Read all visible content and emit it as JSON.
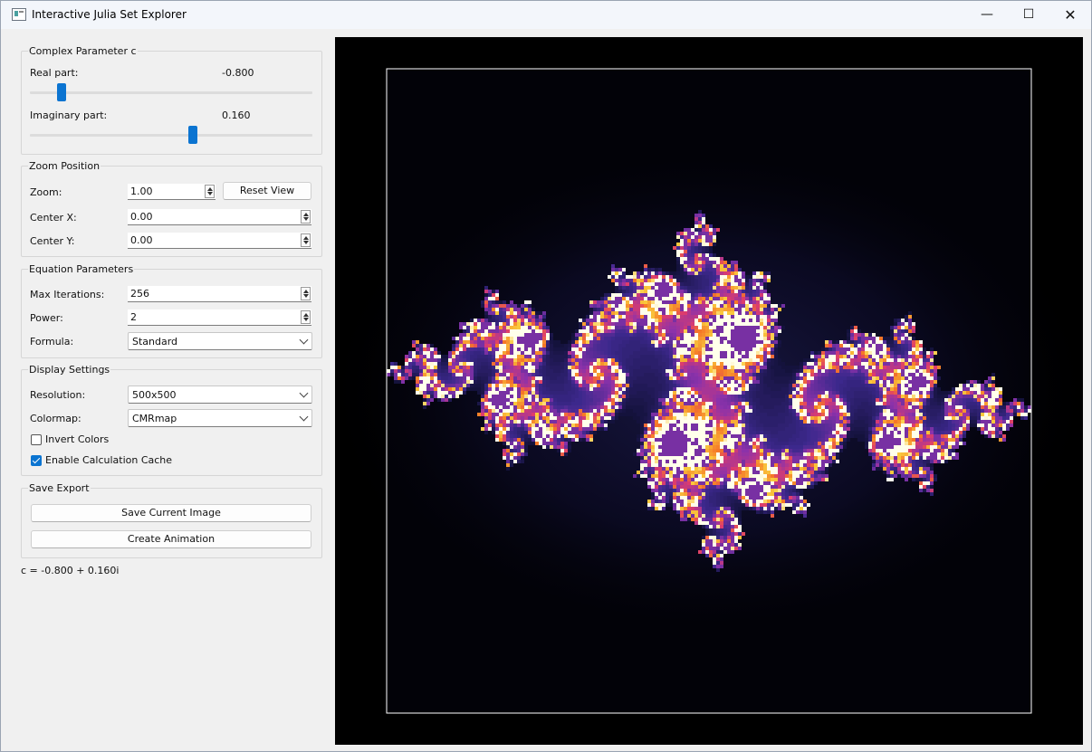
{
  "window": {
    "title": "Interactive Julia Set Explorer"
  },
  "controls": {
    "window_minimize": "—",
    "window_maximize": "☐",
    "window_close": "✕"
  },
  "complex": {
    "group_title": "Complex Parameter c",
    "real_label": "Real part:",
    "real_value": "-0.800",
    "imag_label": "Imaginary part:",
    "imag_value": "0.160",
    "real_slider_fraction": 0.1,
    "imag_slider_fraction": 0.58
  },
  "zoom": {
    "group_title": "Zoom  Position",
    "zoom_label": "Zoom:",
    "zoom_value": "1.00",
    "reset_button": "Reset View",
    "center_x_label": "Center X:",
    "center_x_value": "0.00",
    "center_y_label": "Center Y:",
    "center_y_value": "0.00"
  },
  "equation": {
    "group_title": "Equation Parameters",
    "max_iter_label": "Max Iterations:",
    "max_iter_value": "256",
    "power_label": "Power:",
    "power_value": "2",
    "formula_label": "Formula:",
    "formula_value": "Standard"
  },
  "display": {
    "group_title": "Display Settings",
    "resolution_label": "Resolution:",
    "resolution_value": "500x500",
    "colormap_label": "Colormap:",
    "colormap_value": "CMRmap",
    "invert_label": "Invert Colors",
    "invert_checked": false,
    "cache_label": "Enable Calculation Cache",
    "cache_checked": true
  },
  "export": {
    "group_title": "Save  Export",
    "save_button": "Save Current Image",
    "animate_button": "Create Animation"
  },
  "status": {
    "c_text": "c = -0.800 + 0.160i"
  },
  "render": {
    "c_re": -0.8,
    "c_im": 0.16,
    "accent_color": "#0b74d1",
    "background": "#000000",
    "frame_color": "#ffffff"
  }
}
